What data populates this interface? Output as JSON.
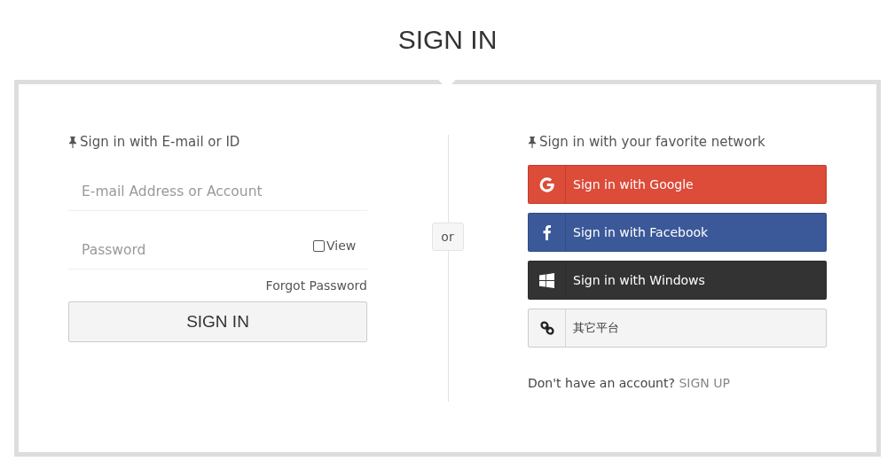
{
  "title": "SIGN IN",
  "email_section": {
    "heading": "Sign in with E-mail or ID",
    "account_field": {
      "placeholder": "E-mail Address or Account"
    },
    "password_field": {
      "placeholder": "Password"
    },
    "view_toggle": {
      "label": "View",
      "checked": false
    },
    "forgot_link": "Forgot Password",
    "submit_button": "SIGN IN"
  },
  "separator": "or",
  "network_section": {
    "heading": "Sign in with your favorite network",
    "providers": [
      {
        "kind": "google",
        "label": "Sign in with Google",
        "color": "#dd4b39"
      },
      {
        "kind": "facebook",
        "label": "Sign in with Facebook",
        "color": "#3b5998"
      },
      {
        "kind": "windows",
        "label": "Sign in with Windows",
        "color": "#333333"
      },
      {
        "kind": "other",
        "label": "其它平台",
        "color": "#f4f4f4"
      }
    ],
    "signup_prompt": "Don't have an account?",
    "signup_link": "SIGN UP"
  }
}
